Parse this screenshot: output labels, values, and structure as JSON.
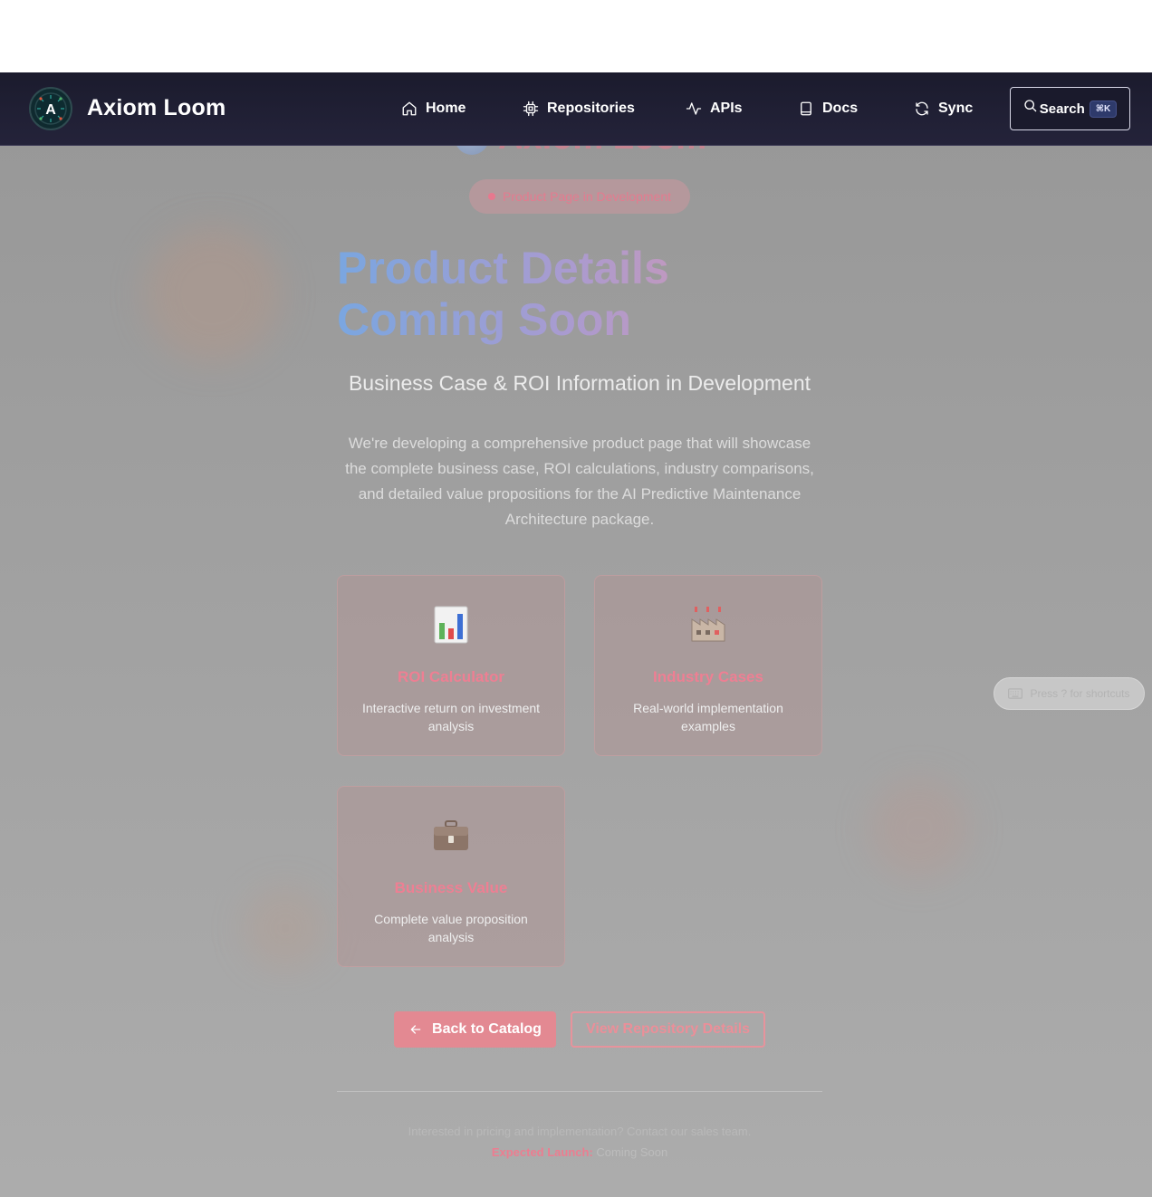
{
  "nav": {
    "brand": "Axiom Loom",
    "items": [
      {
        "label": "Home",
        "icon": "home-icon"
      },
      {
        "label": "Repositories",
        "icon": "chip-icon"
      },
      {
        "label": "APIs",
        "icon": "activity-icon"
      },
      {
        "label": "Docs",
        "icon": "book-icon"
      },
      {
        "label": "Sync",
        "icon": "refresh-icon"
      }
    ],
    "search_label": "Search",
    "search_shortcut": "⌘K"
  },
  "hero": {
    "ghost_brand": "Axiom Loom",
    "status_pill": "Product Page in Development",
    "title": "Product Details Coming Soon",
    "subtitle": "Business Case & ROI Information in Development",
    "description": "We're developing a comprehensive product page that will showcase the complete business case, ROI calculations, industry comparisons, and detailed value propositions for the AI Predictive Maintenance Architecture package."
  },
  "cards": [
    {
      "icon": "bar-chart-icon",
      "title": "ROI Calculator",
      "desc": "Interactive return on investment analysis"
    },
    {
      "icon": "factory-icon",
      "title": "Industry Cases",
      "desc": "Real-world implementation examples"
    },
    {
      "icon": "briefcase-icon",
      "title": "Business Value",
      "desc": "Complete value proposition analysis"
    }
  ],
  "actions": {
    "back": "Back to Catalog",
    "view": "View Repository Details"
  },
  "footer": {
    "contact": "Interested in pricing and implementation? Contact our sales team.",
    "launch_label": "Expected Launch:",
    "launch_value": "Coming Soon"
  },
  "shortcut_hint": "Press ? for shortcuts"
}
